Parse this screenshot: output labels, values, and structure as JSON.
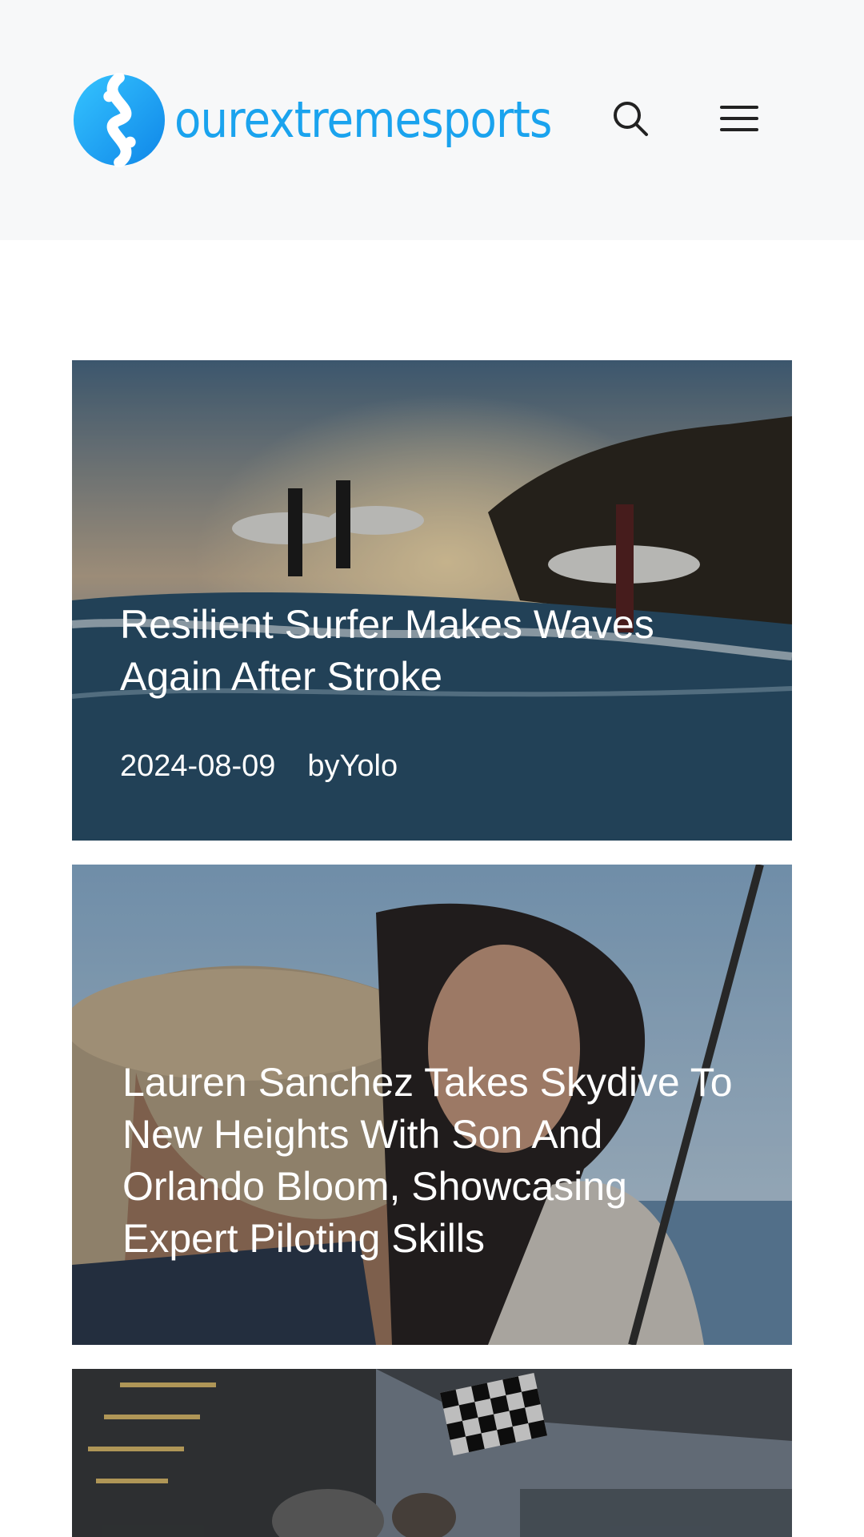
{
  "header": {
    "logo_text": "ourextremesports",
    "search_icon": "search-icon",
    "menu_icon": "hamburger-menu-icon",
    "brand_color": "#1aa3ee"
  },
  "posts": [
    {
      "title": "Resilient Surfer Makes Waves Again After Stroke",
      "date": "2024-08-09",
      "author": "byYolo"
    },
    {
      "title": "Lauren Sanchez Takes Skydive To New Heights With Son And Orlando Bloom, Showcasing Expert Piloting Skills"
    },
    {
      "title": ""
    }
  ]
}
